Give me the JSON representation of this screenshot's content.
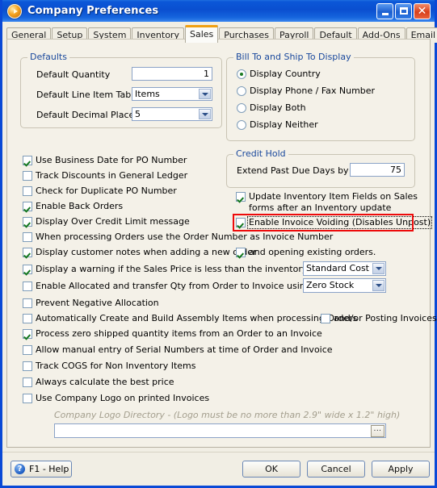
{
  "window": {
    "title": "Company Preferences",
    "icon": "app-orb-icon",
    "controls": {
      "minimize": "Minimize",
      "maximize": "Maximize",
      "close": "Close"
    }
  },
  "tabs": [
    {
      "label": "General",
      "active": false
    },
    {
      "label": "Setup",
      "active": false
    },
    {
      "label": "System",
      "active": false
    },
    {
      "label": "Inventory",
      "active": false
    },
    {
      "label": "Sales",
      "active": true
    },
    {
      "label": "Purchases",
      "active": false
    },
    {
      "label": "Payroll",
      "active": false
    },
    {
      "label": "Default",
      "active": false
    },
    {
      "label": "Add-Ons",
      "active": false
    },
    {
      "label": "Email Setup",
      "active": false
    }
  ],
  "defaults_group": {
    "legend": "Defaults",
    "quantity_label": "Default Quantity",
    "quantity_value": "1",
    "line_item_tab_label": "Default Line Item Tab",
    "line_item_tab_value": "Items",
    "decimal_places_label": "Default Decimal Places",
    "decimal_places_value": "5"
  },
  "bill_ship_group": {
    "legend": "Bill To and Ship To Display",
    "options": [
      {
        "label": "Display Country",
        "selected": true
      },
      {
        "label": "Display Phone / Fax Number",
        "selected": false
      },
      {
        "label": "Display Both",
        "selected": false
      },
      {
        "label": "Display Neither",
        "selected": false
      }
    ]
  },
  "credit_hold_group": {
    "legend": "Credit Hold",
    "extend_label": "Extend Past Due Days by",
    "extend_value": "75"
  },
  "right_checkboxes": [
    {
      "label": "Update Inventory Item Fields on Sales",
      "checked": true
    },
    {
      "label": "forms after an Inventory update",
      "checked": null
    },
    {
      "label": "Enable Invoice Voiding (Disables Unpost)",
      "checked": true,
      "focused": true,
      "highlighted": true
    }
  ],
  "left_checkboxes": [
    {
      "label": "Use Business Date for PO Number",
      "checked": true
    },
    {
      "label": "Track Discounts in General Ledger",
      "checked": false
    },
    {
      "label": "Check for Duplicate PO Number",
      "checked": false
    },
    {
      "label": "Enable Back Orders",
      "checked": true
    },
    {
      "label": "Display Over Credit Limit message",
      "checked": true
    },
    {
      "label": "When processing Orders use the Order Number as Invoice Number",
      "checked": false
    },
    {
      "label": "Display customer notes when adding a new order",
      "checked": true
    },
    {
      "label": "Display a warning if the Sales Price is less than the inventory items",
      "checked": true
    },
    {
      "label": "Enable Allocated and transfer Qty from Order to Invoice using :",
      "checked": false
    },
    {
      "label": "Prevent Negative Allocation",
      "checked": false
    },
    {
      "label": "Automatically Create and Build Assembly Items when processing Orders",
      "checked": false
    },
    {
      "label": "Process zero shipped quantity items from an Order to an Invoice",
      "checked": true
    },
    {
      "label": "Allow manual entry of Serial Numbers at time of Order and Invoice",
      "checked": false
    },
    {
      "label": "Track COGS for Non Inventory Items",
      "checked": false
    },
    {
      "label": "Always calculate the best price",
      "checked": false
    },
    {
      "label": "Use Company Logo on printed Invoices",
      "checked": false
    }
  ],
  "inline": {
    "opening_existing_orders": {
      "label": "and opening existing orders.",
      "checked": true
    },
    "posting_invoices": {
      "label": "and/or Posting Invoices",
      "checked": false
    },
    "sales_price_basis": "Standard Cost",
    "allocation_basis": "Zero Stock"
  },
  "logo": {
    "directory_label": "Company Logo Directory - (Logo must be no more than 2.9\" wide x 1.2\" high)",
    "directory_value": "",
    "browse_label": "..."
  },
  "footer": {
    "help_label": "F1 - Help",
    "ok_label": "OK",
    "cancel_label": "Cancel",
    "apply_label": "Apply"
  },
  "colors": {
    "title_blue": "#0a4fd0",
    "accent_orange": "#f0a012",
    "legend_blue": "#19489c",
    "highlight_red": "#ee0b0b",
    "panel_bg": "#f4f1e8"
  }
}
